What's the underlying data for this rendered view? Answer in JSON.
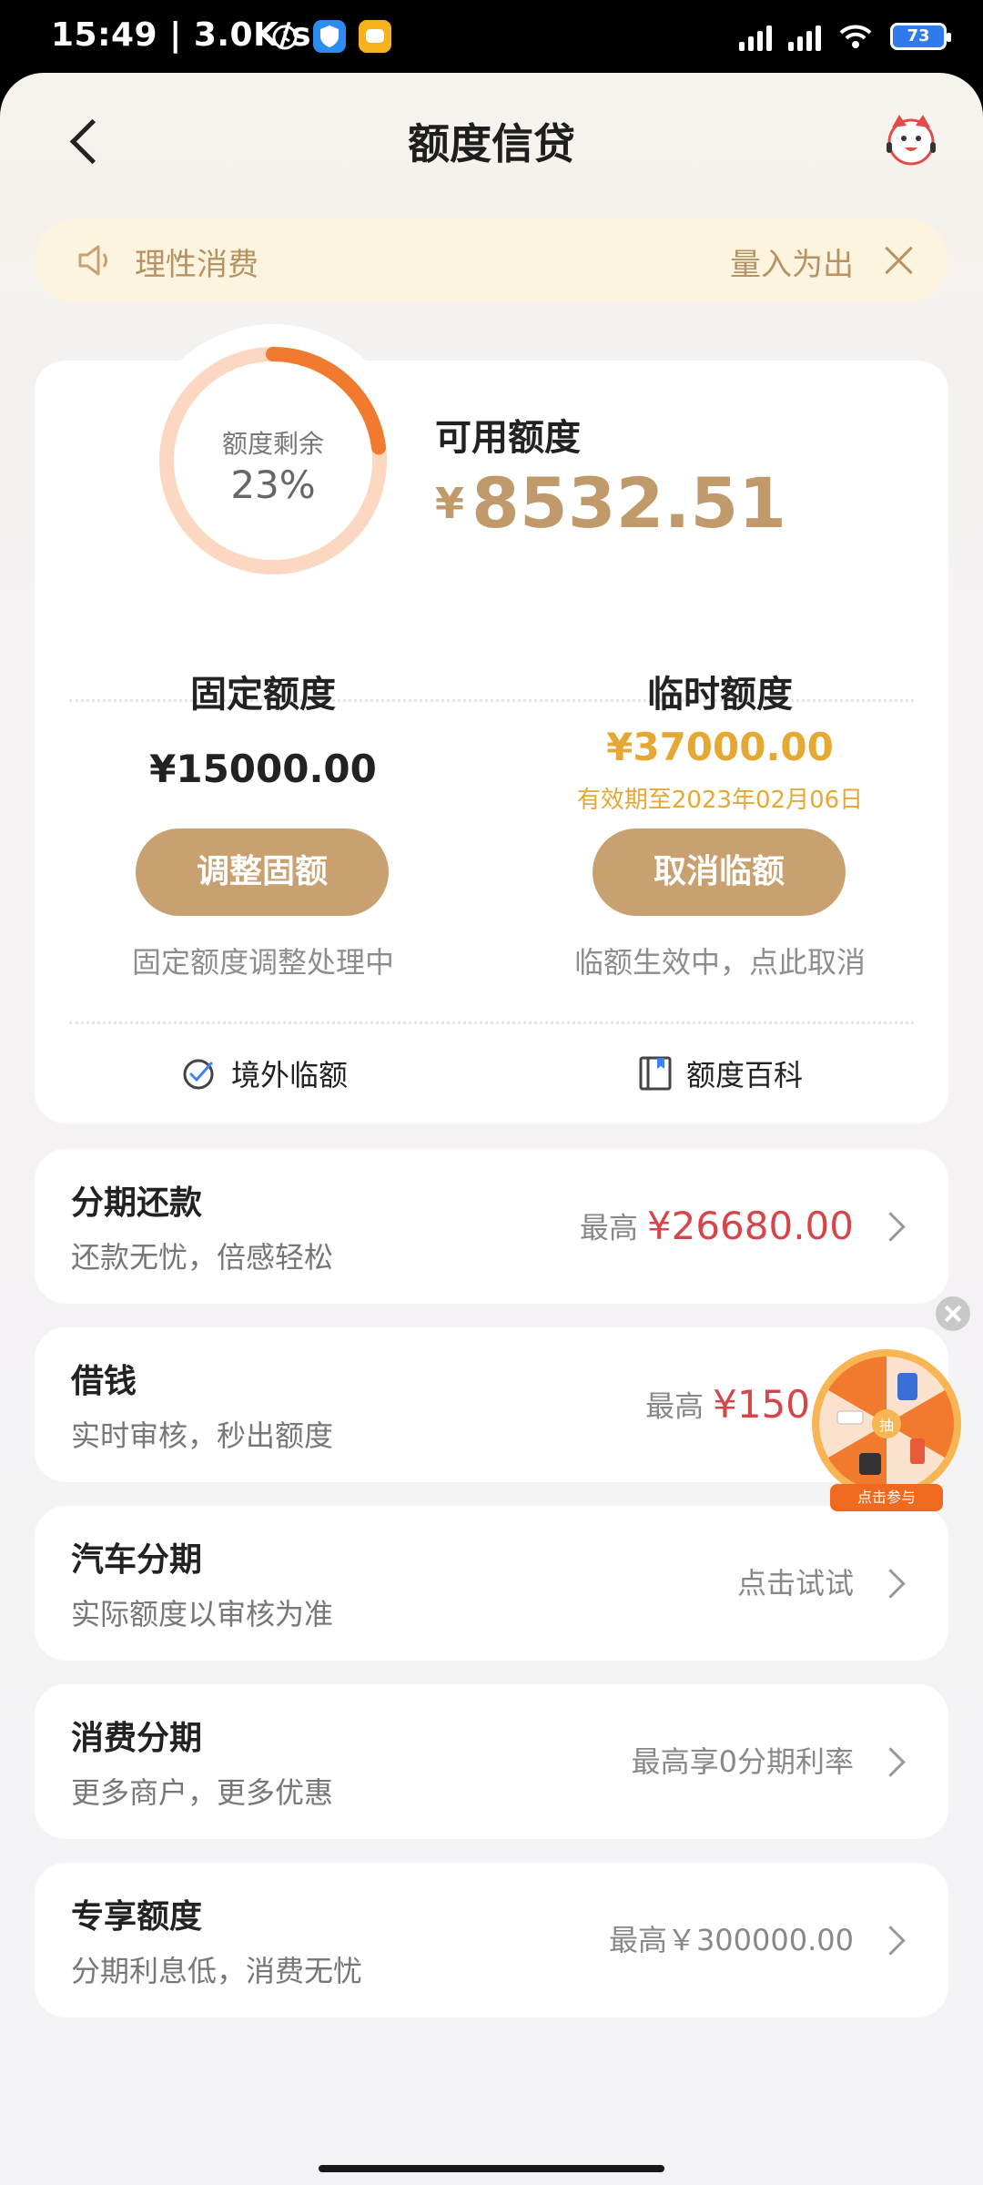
{
  "status_bar": {
    "time": "15:49",
    "speed": "3.0K/s",
    "battery": "73",
    "icons": [
      "alarm-icon",
      "shield-app-icon",
      "chat-app-icon",
      "signal-icon",
      "wifi-icon",
      "battery-icon"
    ]
  },
  "nav": {
    "title": "额度信贷",
    "back_icon": "chevron-left-icon",
    "mascot_icon": "mascot-icon"
  },
  "notice": {
    "left_text": "理性消费",
    "right_text": "量入为出"
  },
  "quota": {
    "ring_label": "额度剩余",
    "ring_value": "23%",
    "ring_fraction": 0.23,
    "available_label": "可用额度",
    "currency": "¥",
    "available_amount": "8532.51",
    "fixed": {
      "title": "固定额度",
      "amount": "¥15000.00",
      "button": "调整固额",
      "status": "固定额度调整处理中"
    },
    "temporary": {
      "title": "临时额度",
      "amount": "¥37000.00",
      "valid_until": "有效期至2023年02月06日",
      "button": "取消临额",
      "status": "临额生效中，点此取消"
    },
    "links": {
      "overseas": "境外临额",
      "encyclopedia": "额度百科"
    }
  },
  "rows": [
    {
      "title": "分期还款",
      "subtitle": "还款无忧，倍感轻松",
      "right_label": "最高",
      "right_value": "¥26680.00"
    },
    {
      "title": "借钱",
      "subtitle": "实时审核，秒出额度",
      "right_label": "最高",
      "right_value": "¥150"
    },
    {
      "title": "汽车分期",
      "subtitle": "实际额度以审核为准",
      "right_label": "点击试试",
      "right_value": ""
    },
    {
      "title": "消费分期",
      "subtitle": "更多商户，更多优惠",
      "right_label": "最高享0分期利率",
      "right_value": ""
    },
    {
      "title": "专享额度",
      "subtitle": "分期利息低，消费无忧",
      "right_label": "最高￥300000.00",
      "right_value": ""
    }
  ],
  "float_widget": {
    "center": "抽",
    "cta": "点击参与"
  },
  "colors": {
    "gold": "#c9a171",
    "amount_gold": "#c19a6b",
    "red": "#d5464b",
    "ring_orange": "#f27a2f",
    "ring_track": "#fcd8c2",
    "notice_bg": "#fdf4e0"
  }
}
